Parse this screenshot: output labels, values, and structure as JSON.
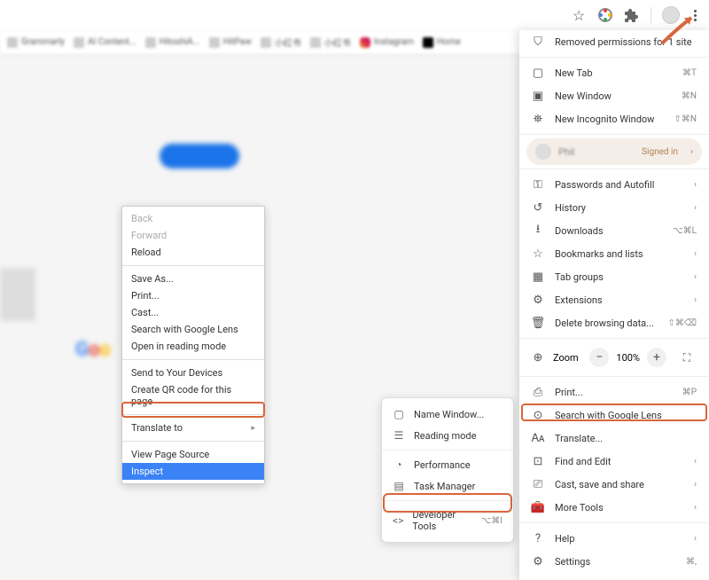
{
  "browser_top": {
    "icons": [
      "star",
      "colorwheel",
      "puzzle",
      "avatar",
      "menu"
    ]
  },
  "bookmarks": [
    {
      "label": "Grammarly"
    },
    {
      "label": "AI Content..."
    },
    {
      "label": "HitoshiA..."
    },
    {
      "label": "HitPaw"
    },
    {
      "label": "小红书"
    },
    {
      "label": "小红书"
    },
    {
      "label": "Instagram",
      "class": "ig"
    },
    {
      "label": "Home",
      "class": "x"
    }
  ],
  "context_menu": {
    "back": "Back",
    "forward": "Forward",
    "reload": "Reload",
    "save_as": "Save As...",
    "print": "Print...",
    "cast": "Cast...",
    "search_lens": "Search with Google Lens",
    "reading_mode": "Open in reading mode",
    "send_devices": "Send to Your Devices",
    "qr_code": "Create QR code for this page",
    "translate": "Translate to",
    "view_source": "View Page Source",
    "inspect": "Inspect"
  },
  "submenu": {
    "name_window": "Name Window...",
    "reading_mode": "Reading mode",
    "performance": "Performance",
    "task_manager": "Task Manager",
    "dev_tools": "Developer Tools",
    "dev_tools_shortcut": "⌥⌘I"
  },
  "main_menu": {
    "removed_perms": "Removed permissions for 1 site",
    "new_tab": "New Tab",
    "new_tab_sc": "⌘T",
    "new_window": "New Window",
    "new_window_sc": "⌘N",
    "incognito": "New Incognito Window",
    "incognito_sc": "⇧⌘N",
    "profile_name": "Phil",
    "signed_in": "Signed in",
    "passwords": "Passwords and Autofill",
    "history": "History",
    "downloads": "Downloads",
    "downloads_sc": "⌥⌘L",
    "bookmarks": "Bookmarks and lists",
    "tab_groups": "Tab groups",
    "extensions": "Extensions",
    "delete_data": "Delete browsing data...",
    "delete_data_sc": "⇧⌘⌫",
    "zoom_label": "Zoom",
    "zoom_val": "100%",
    "print": "Print...",
    "print_sc": "⌘P",
    "search_lens": "Search with Google Lens",
    "translate": "Translate...",
    "find_edit": "Find and Edit",
    "cast_save": "Cast, save and share",
    "more_tools": "More Tools",
    "help": "Help",
    "settings": "Settings",
    "settings_sc": "⌘,"
  }
}
